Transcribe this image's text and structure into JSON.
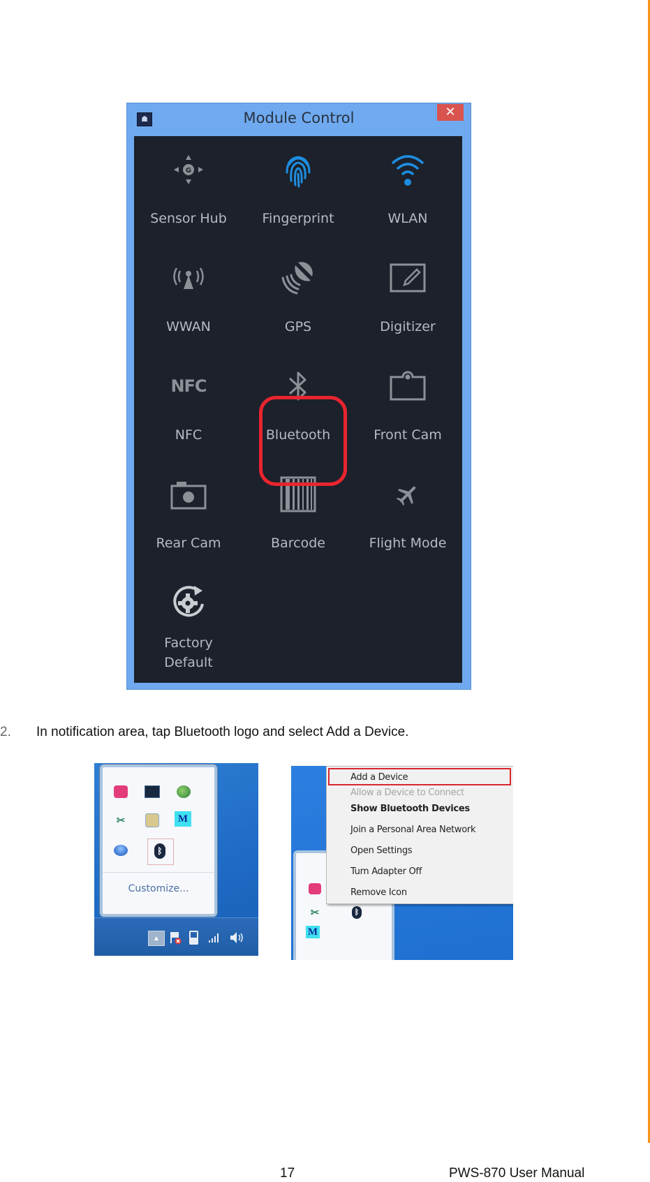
{
  "module_control": {
    "title": "Module Control",
    "close_glyph": "✕",
    "app_icon_glyph": "☗",
    "tiles": [
      {
        "label": "Sensor Hub",
        "icon": "sensor-hub-icon",
        "color": "#8C9097"
      },
      {
        "label": "Fingerprint",
        "icon": "fingerprint-icon",
        "color": "#1E8DE0"
      },
      {
        "label": "WLAN",
        "icon": "wifi-icon",
        "color": "#1E8DE0"
      },
      {
        "label": "WWAN",
        "icon": "cell-tower-icon",
        "color": "#8C9097"
      },
      {
        "label": "GPS",
        "icon": "gps-satellite-icon",
        "color": "#8C9097"
      },
      {
        "label": "Digitizer",
        "icon": "digitizer-pen-icon",
        "color": "#8C9097"
      },
      {
        "label": "NFC",
        "icon": "nfc-icon",
        "icon_text": "NFC",
        "color": "#8C9097"
      },
      {
        "label": "Bluetooth",
        "icon": "bluetooth-icon",
        "color": "#8C9097",
        "highlighted": true
      },
      {
        "label": "Front Cam",
        "icon": "front-camera-icon",
        "color": "#8C9097"
      },
      {
        "label": "Rear Cam",
        "icon": "rear-camera-icon",
        "color": "#8C9097"
      },
      {
        "label": "Barcode",
        "icon": "barcode-icon",
        "color": "#8C9097"
      },
      {
        "label": "Flight Mode",
        "icon": "airplane-icon",
        "color": "#8C9097"
      },
      {
        "label": "Factory\nDefault",
        "label_line1": "Factory",
        "label_line2": "Default",
        "icon": "factory-reset-icon",
        "color": "#C9CCD1"
      }
    ],
    "highlight_color": "#E8252F"
  },
  "step": {
    "number": "2.",
    "text": "In notification area, tap Bluetooth logo and select Add a Device."
  },
  "tray_popup": {
    "icons": [
      "app-pink-icon",
      "monitor-icon",
      "globe-network-icon",
      "tools-icon",
      "document-icon",
      "m-app-icon",
      "blue-orb-icon",
      "bluetooth-tray-icon"
    ],
    "m_letter": "M",
    "customize_label": "Customize...",
    "taskbar_icons": [
      "show-hidden-icons-button",
      "action-center-flag-icon",
      "battery-icon",
      "signal-strength-icon",
      "volume-icon"
    ]
  },
  "bluetooth_menu": {
    "items": [
      {
        "label": "Add a Device",
        "state": "highlighted"
      },
      {
        "label": "Allow a Device to Connect",
        "state": "disabled"
      },
      {
        "label": "Show Bluetooth Devices",
        "state": "bold"
      },
      {
        "label": "Join a Personal Area Network",
        "state": "normal"
      },
      {
        "label": "Open Settings",
        "state": "normal"
      },
      {
        "label": "Turn Adapter Off",
        "state": "normal"
      },
      {
        "label": "Remove Icon",
        "state": "normal"
      }
    ]
  },
  "footer": {
    "page_number": "17",
    "manual_title": "PWS-870 User Manual"
  },
  "accent_color": "#F7941D"
}
